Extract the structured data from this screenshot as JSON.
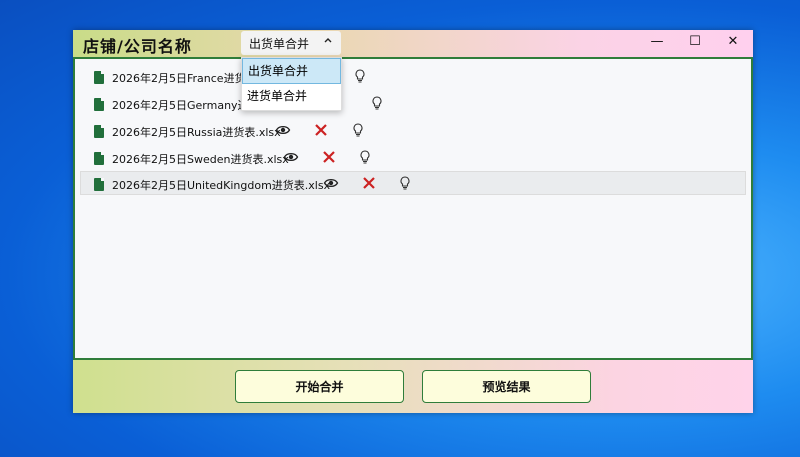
{
  "window": {
    "title": "店铺/公司名称",
    "merge_type": {
      "selected": "出货单合并",
      "options": [
        "出货单合并",
        "进货单合并"
      ]
    },
    "controls": {
      "minimize": "—",
      "maximize": "☐",
      "close": "✕"
    }
  },
  "files": [
    {
      "name": "2026年2月5日France进货表.xlsx"
    },
    {
      "name": "2026年2月5日Germany进货表.xlsx"
    },
    {
      "name": "2026年2月5日Russia进货表.xlsx"
    },
    {
      "name": "2026年2月5日Sweden进货表.xlsx"
    },
    {
      "name": "2026年2月5日UnitedKingdom进货表.xlsx"
    }
  ],
  "footer": {
    "start_label": "开始合并",
    "preview_label": "预览结果"
  },
  "colors": {
    "accent_green": "#2f7d3a",
    "delete_red": "#cc2222",
    "file_icon": "#216f3b"
  }
}
